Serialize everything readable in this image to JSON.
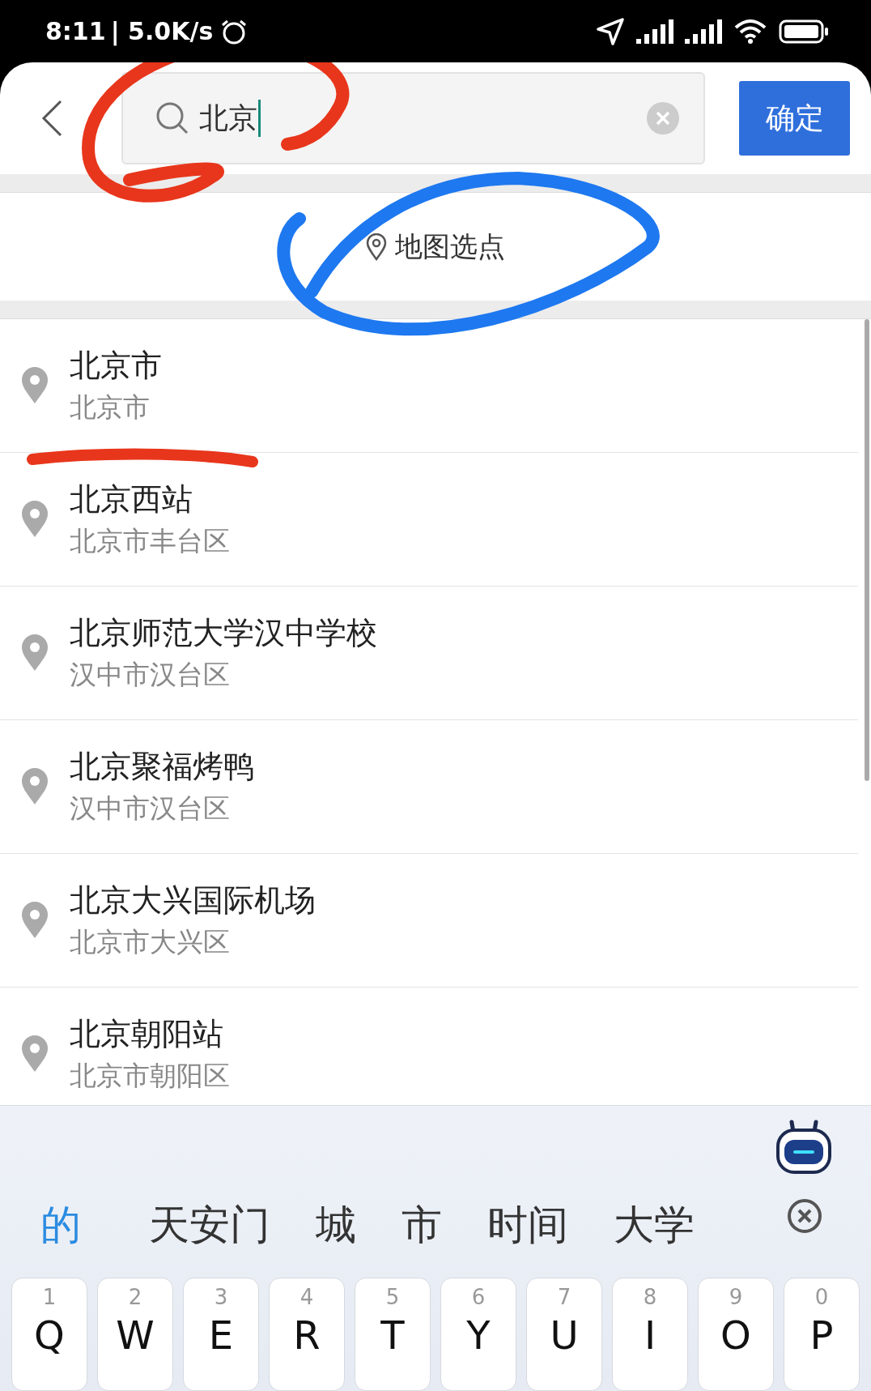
{
  "status_bar": {
    "time": "8:11",
    "speed": "| 5.0K/s"
  },
  "search": {
    "value": "北京"
  },
  "confirm_button": "确定",
  "map_pick": "地图选点",
  "results": [
    {
      "title": "北京市",
      "subtitle": "北京市"
    },
    {
      "title": "北京西站",
      "subtitle": "北京市丰台区"
    },
    {
      "title": "北京师范大学汉中学校",
      "subtitle": "汉中市汉台区"
    },
    {
      "title": "北京聚福烤鸭",
      "subtitle": "汉中市汉台区"
    },
    {
      "title": "北京大兴国际机场",
      "subtitle": "北京市大兴区"
    },
    {
      "title": "北京朝阳站",
      "subtitle": "北京市朝阳区"
    }
  ],
  "keyboard": {
    "candidates": [
      {
        "text": "的",
        "selected": true
      },
      {
        "text": "天安门",
        "selected": false
      },
      {
        "text": "城",
        "selected": false
      },
      {
        "text": "市",
        "selected": false
      },
      {
        "text": "时间",
        "selected": false
      },
      {
        "text": "大学",
        "selected": false
      }
    ],
    "keys": [
      {
        "digit": "1",
        "letter": "Q"
      },
      {
        "digit": "2",
        "letter": "W"
      },
      {
        "digit": "3",
        "letter": "E"
      },
      {
        "digit": "4",
        "letter": "R"
      },
      {
        "digit": "5",
        "letter": "T"
      },
      {
        "digit": "6",
        "letter": "Y"
      },
      {
        "digit": "7",
        "letter": "U"
      },
      {
        "digit": "8",
        "letter": "I"
      },
      {
        "digit": "9",
        "letter": "O"
      },
      {
        "digit": "0",
        "letter": "P"
      }
    ]
  }
}
